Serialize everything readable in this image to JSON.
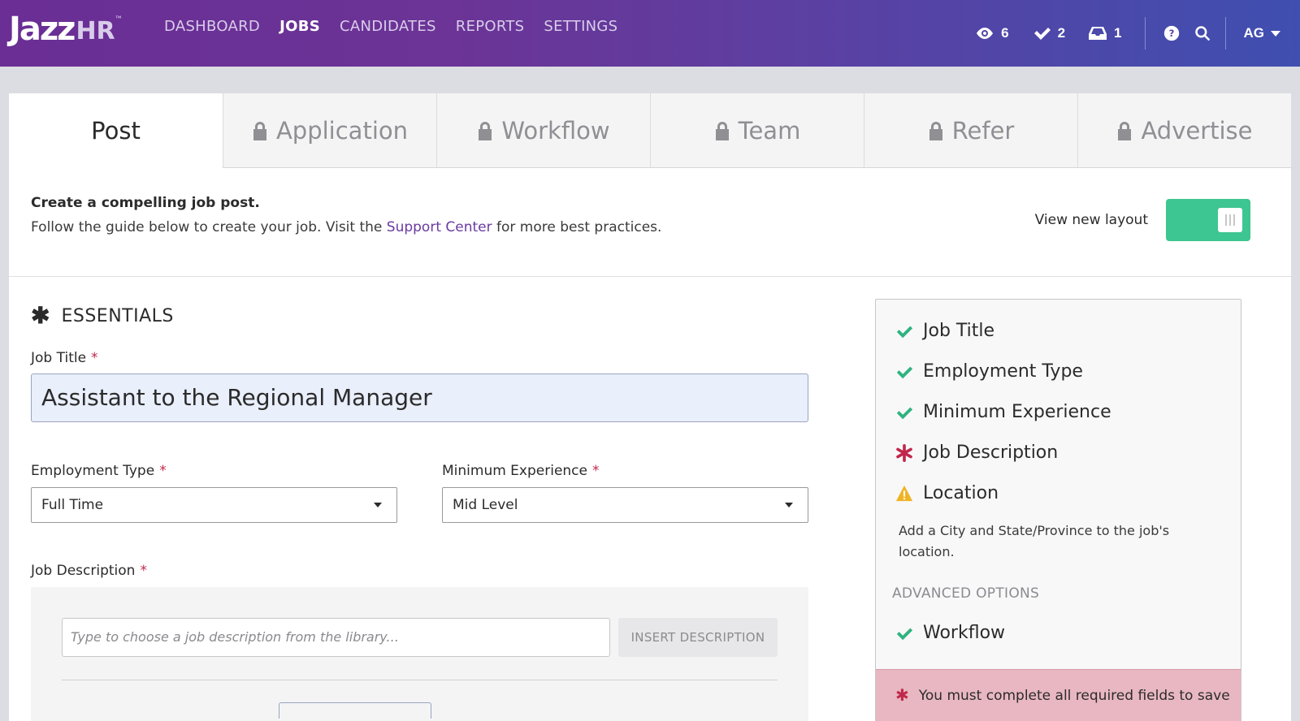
{
  "brand": {
    "logo_main": "Jazz",
    "logo_suffix": "HR",
    "logo_tm": "™"
  },
  "nav": {
    "items": [
      "DASHBOARD",
      "JOBS",
      "CANDIDATES",
      "REPORTS",
      "SETTINGS"
    ],
    "active": "JOBS",
    "counts": {
      "views": "6",
      "tasks": "2",
      "inbox": "1"
    },
    "user_initials": "AG"
  },
  "tabs": [
    {
      "label": "Post",
      "locked": false,
      "active": true
    },
    {
      "label": "Application",
      "locked": true
    },
    {
      "label": "Workflow",
      "locked": true
    },
    {
      "label": "Team",
      "locked": true
    },
    {
      "label": "Refer",
      "locked": true
    },
    {
      "label": "Advertise",
      "locked": true
    }
  ],
  "intro": {
    "heading": "Create a compelling job post.",
    "text_before": "Follow the guide below to create your job. Visit the ",
    "link": "Support Center",
    "text_after": " for more best practices."
  },
  "layout_toggle": {
    "label": "View new layout",
    "on": true
  },
  "essentials": {
    "title": "ESSENTIALS",
    "job_title_label": "Job Title",
    "job_title_value": "Assistant to the Regional Manager",
    "employment_type_label": "Employment Type",
    "employment_type_value": "Full Time",
    "min_experience_label": "Minimum Experience",
    "min_experience_value": "Mid Level",
    "job_description_label": "Job Description",
    "description_placeholder": "Type to choose a job description from the library...",
    "insert_button": "INSERT DESCRIPTION",
    "required_mark": "*"
  },
  "checklist": {
    "items": [
      {
        "label": "Job Title",
        "status": "done"
      },
      {
        "label": "Employment Type",
        "status": "done"
      },
      {
        "label": "Minimum Experience",
        "status": "done"
      },
      {
        "label": "Job Description",
        "status": "required"
      },
      {
        "label": "Location",
        "status": "warning"
      }
    ],
    "location_note": "Add a City and State/Province to the job's location.",
    "advanced_heading": "ADVANCED OPTIONS",
    "advanced_items": [
      {
        "label": "Workflow",
        "status": "done"
      }
    ],
    "alert": "You must complete all required fields to save"
  },
  "colors": {
    "nav_gradient_start": "#6a2e95",
    "nav_gradient_end": "#3f4fb0",
    "success": "#2fb37f",
    "toggle": "#3dc592",
    "required": "#c0284b",
    "warning": "#f0b323",
    "link": "#6a3aa0",
    "alert_bg": "#e8b7c2"
  }
}
